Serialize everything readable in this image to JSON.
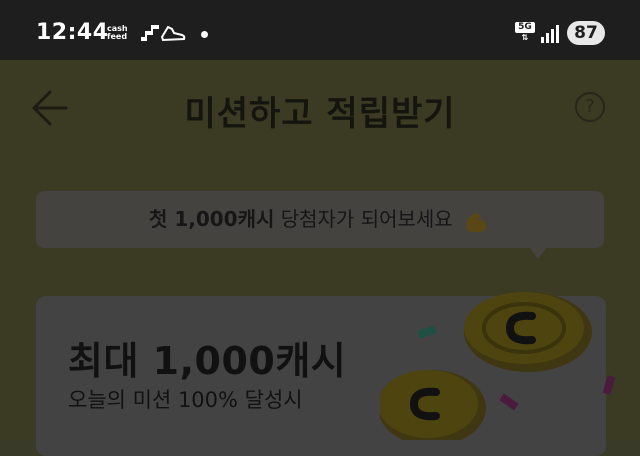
{
  "status_bar": {
    "time": "12:44",
    "app_badge_line1": "cash",
    "app_badge_line2": "feed",
    "network": "5G",
    "battery": "87"
  },
  "header": {
    "title": "미션하고 적립받기",
    "help_label": "?"
  },
  "banner": {
    "prefix": "첫 ",
    "highlight": "1,000캐시",
    "suffix": " 당첨자가 되어보세요"
  },
  "card": {
    "title": "최대 1,000캐시",
    "subtitle": "오늘의 미션 100% 달성시"
  },
  "colors": {
    "accent_yellow": "#F5E100",
    "overlay": "#000000"
  }
}
